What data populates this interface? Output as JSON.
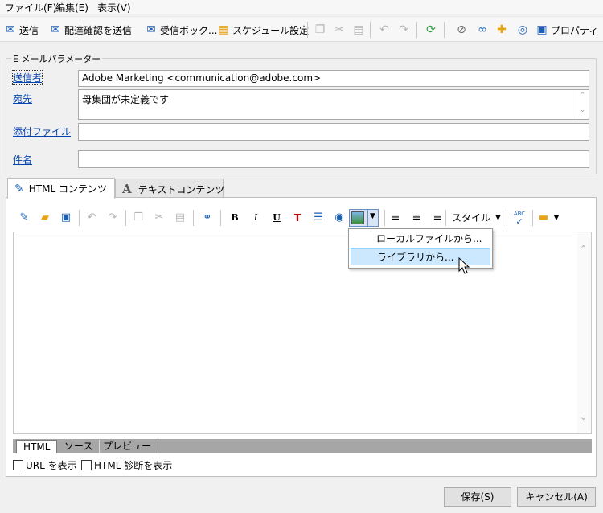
{
  "menu": {
    "file": "ファイル(F)",
    "edit": "編集(E)",
    "view": "表示(V)"
  },
  "toolbar": {
    "send": "送信",
    "send_proof": "配達確認を送信",
    "inbox": "受信ボック...",
    "schedule": "スケジュール設定",
    "properties": "プロパティ"
  },
  "params": {
    "legend": "E メールパラメーター",
    "sender_label": "送信者",
    "sender_value": "Adobe Marketing <communication@adobe.com>",
    "to_label": "宛先",
    "to_value": "母集団が未定義です",
    "attach_label": "添付ファイル",
    "attach_value": "",
    "subject_label": "件名",
    "subject_value": ""
  },
  "tabs": {
    "html": "HTML コンテンツ",
    "text": "テキストコンテンツ"
  },
  "editor_toolbar": {
    "style": "スタイル",
    "bold": "B",
    "italic": "I",
    "underline": "U",
    "spell": "ABC"
  },
  "image_menu": {
    "local": "ローカルファイルから...",
    "library": "ライブラリから..."
  },
  "bottom_tabs": {
    "html": "HTML",
    "source": "ソース",
    "preview": "プレビュー"
  },
  "options": {
    "show_url": "URL を表示",
    "show_diag": "HTML 診断を表示"
  },
  "buttons": {
    "save": "保存(S)",
    "cancel": "キャンセル(A)"
  },
  "colors": {
    "link": "#0645ad",
    "highlight": "#cce8ff",
    "accent_blue": "#1a5fb4",
    "icon_orange": "#e8a317"
  }
}
